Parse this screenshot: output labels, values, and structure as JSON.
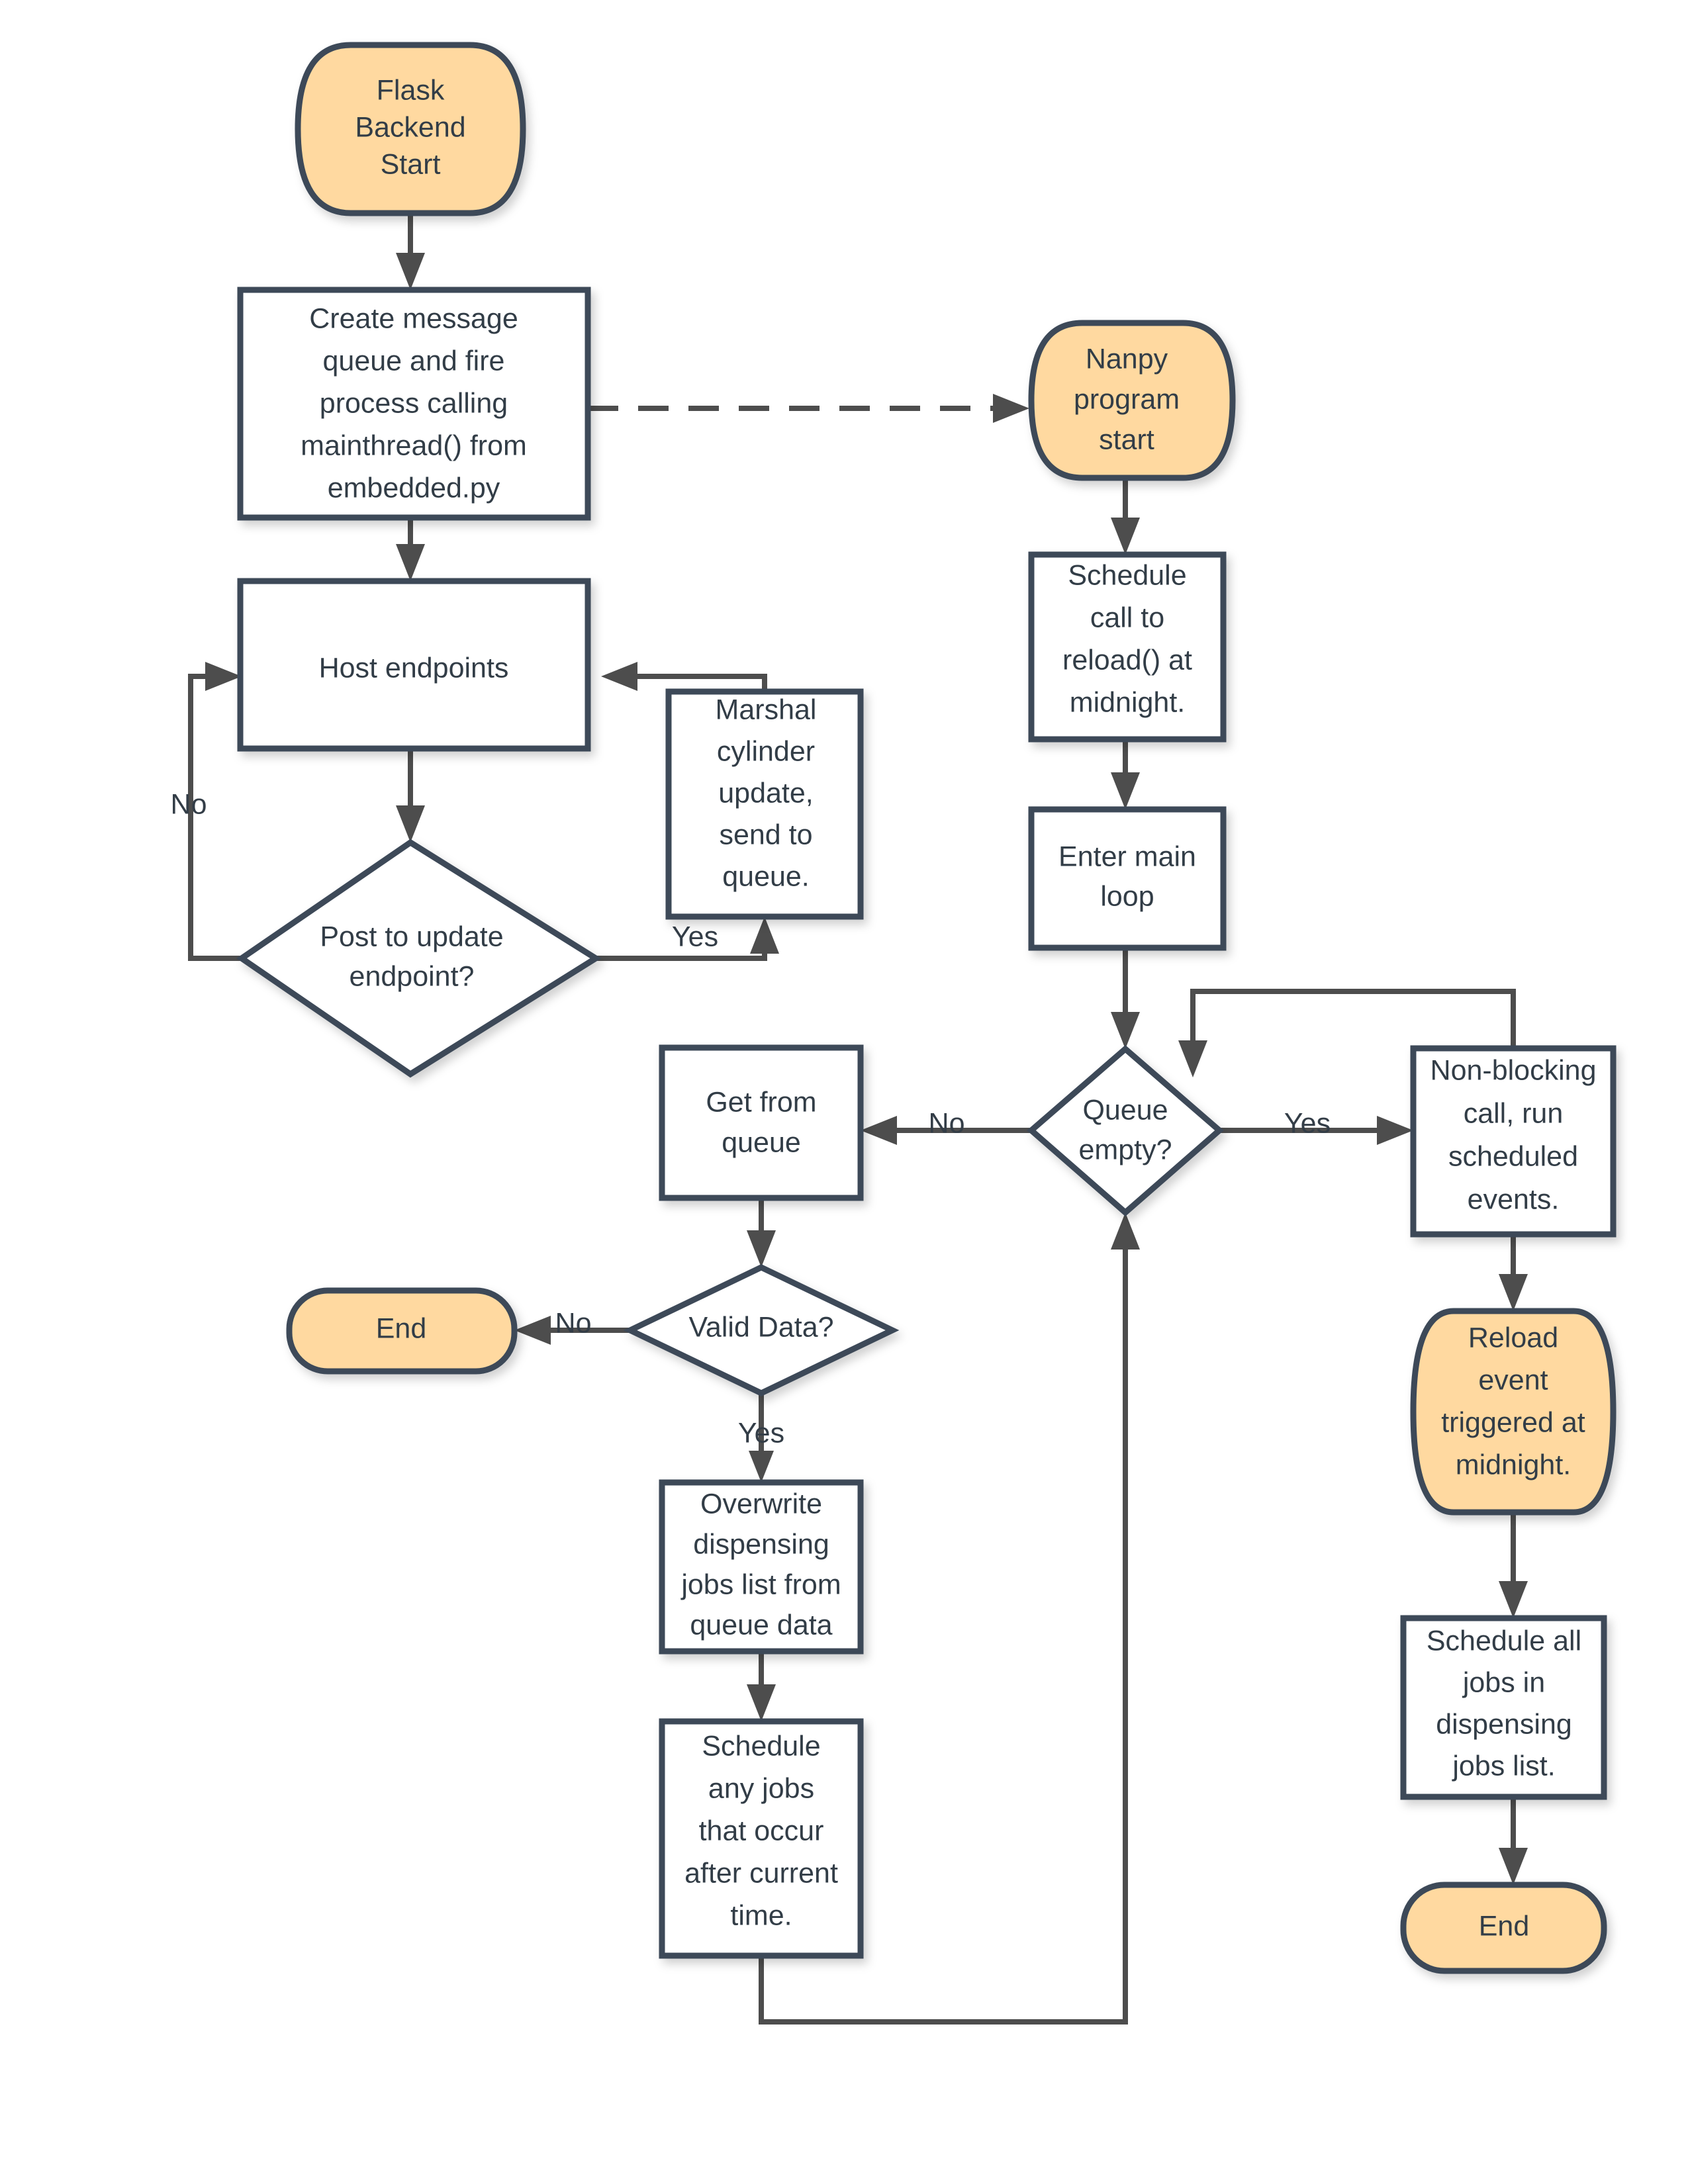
{
  "diagram": {
    "title": "Flask Backend and Nanpy program flowchart",
    "type": "flowchart",
    "colors": {
      "terminator_fill": "#ffd9a0",
      "process_fill": "#ffffff",
      "stroke": "#3c4858",
      "edge": "#4d4d4d",
      "text": "#333d47",
      "background": "#ffffff"
    },
    "nodes": {
      "flask_start": {
        "shape": "terminator",
        "lines": [
          "Flask",
          "Backend",
          "Start"
        ]
      },
      "create_queue": {
        "shape": "process",
        "lines": [
          "Create message",
          "queue and fire",
          "process calling",
          "mainthread() from",
          "embedded.py"
        ]
      },
      "host_endpoints": {
        "shape": "process",
        "lines": [
          "Host endpoints"
        ]
      },
      "post_update": {
        "shape": "decision",
        "lines": [
          "Post to update",
          "endpoint?"
        ]
      },
      "marshal_cylinder": {
        "shape": "process",
        "lines": [
          "Marshal",
          "cylinder",
          "update,",
          "send to",
          "queue."
        ]
      },
      "nanpy_start": {
        "shape": "terminator",
        "lines": [
          "Nanpy",
          "program",
          "start"
        ]
      },
      "schedule_reload": {
        "shape": "process",
        "lines": [
          "Schedule",
          "call to",
          "reload() at",
          "midnight."
        ]
      },
      "enter_main_loop": {
        "shape": "process",
        "lines": [
          "Enter main",
          "loop"
        ]
      },
      "queue_empty": {
        "shape": "decision",
        "lines": [
          "Queue",
          "empty?"
        ]
      },
      "get_from_queue": {
        "shape": "process",
        "lines": [
          "Get from",
          "queue"
        ]
      },
      "nonblocking_call": {
        "shape": "process",
        "lines": [
          "Non-blocking",
          "call, run",
          "scheduled",
          "events."
        ]
      },
      "valid_data": {
        "shape": "decision",
        "lines": [
          "Valid Data?"
        ]
      },
      "end_left": {
        "shape": "terminator",
        "lines": [
          "End"
        ]
      },
      "reload_event": {
        "shape": "terminator",
        "lines": [
          "Reload",
          "event",
          "triggered at",
          "midnight."
        ]
      },
      "overwrite_jobs": {
        "shape": "process",
        "lines": [
          "Overwrite",
          "dispensing",
          "jobs list from",
          "queue data"
        ]
      },
      "schedule_all_jobs": {
        "shape": "process",
        "lines": [
          "Schedule all",
          "jobs in",
          "dispensing",
          "jobs list."
        ]
      },
      "schedule_any_jobs": {
        "shape": "process",
        "lines": [
          "Schedule",
          "any jobs",
          "that occur",
          "after current",
          "time."
        ]
      },
      "end_right": {
        "shape": "terminator",
        "lines": [
          "End"
        ]
      }
    },
    "edge_labels": {
      "post_update_no": "No",
      "post_update_yes": "Yes",
      "queue_empty_no": "No",
      "queue_empty_yes": "Yes",
      "valid_data_no": "No",
      "valid_data_yes": "Yes"
    },
    "edges": [
      {
        "from": "flask_start",
        "to": "create_queue",
        "style": "solid",
        "label": ""
      },
      {
        "from": "create_queue",
        "to": "nanpy_start",
        "style": "dashed",
        "label": ""
      },
      {
        "from": "create_queue",
        "to": "host_endpoints",
        "style": "solid",
        "label": ""
      },
      {
        "from": "host_endpoints",
        "to": "post_update",
        "style": "solid",
        "label": ""
      },
      {
        "from": "post_update",
        "to": "host_endpoints",
        "style": "solid",
        "label": "No"
      },
      {
        "from": "post_update",
        "to": "marshal_cylinder",
        "style": "solid",
        "label": "Yes"
      },
      {
        "from": "marshal_cylinder",
        "to": "host_endpoints",
        "style": "solid",
        "label": ""
      },
      {
        "from": "nanpy_start",
        "to": "schedule_reload",
        "style": "solid",
        "label": ""
      },
      {
        "from": "schedule_reload",
        "to": "enter_main_loop",
        "style": "solid",
        "label": ""
      },
      {
        "from": "enter_main_loop",
        "to": "queue_empty",
        "style": "solid",
        "label": ""
      },
      {
        "from": "queue_empty",
        "to": "get_from_queue",
        "style": "solid",
        "label": "No"
      },
      {
        "from": "queue_empty",
        "to": "nonblocking_call",
        "style": "solid",
        "label": "Yes"
      },
      {
        "from": "nonblocking_call",
        "to": "queue_empty",
        "style": "solid",
        "label": ""
      },
      {
        "from": "nonblocking_call",
        "to": "reload_event",
        "style": "solid",
        "label": ""
      },
      {
        "from": "get_from_queue",
        "to": "valid_data",
        "style": "solid",
        "label": ""
      },
      {
        "from": "valid_data",
        "to": "end_left",
        "style": "solid",
        "label": "No"
      },
      {
        "from": "valid_data",
        "to": "overwrite_jobs",
        "style": "solid",
        "label": "Yes"
      },
      {
        "from": "overwrite_jobs",
        "to": "schedule_any_jobs",
        "style": "solid",
        "label": ""
      },
      {
        "from": "schedule_any_jobs",
        "to": "queue_empty",
        "style": "solid",
        "label": ""
      },
      {
        "from": "reload_event",
        "to": "schedule_all_jobs",
        "style": "solid",
        "label": ""
      },
      {
        "from": "schedule_all_jobs",
        "to": "end_right",
        "style": "solid",
        "label": ""
      }
    ]
  }
}
